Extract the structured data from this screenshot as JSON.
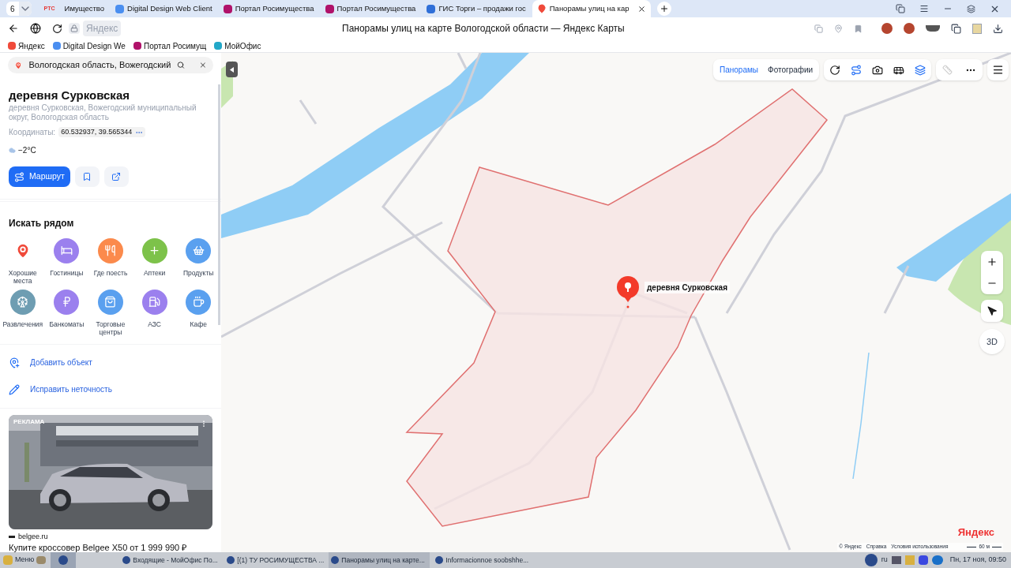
{
  "browser": {
    "tab_count": "6",
    "tabs": [
      {
        "title": "Имущество",
        "badge": "РТС",
        "selected": false
      },
      {
        "title": "Digital Design Web Client",
        "selected": false
      },
      {
        "title": "Портал Росимущества",
        "selected": false
      },
      {
        "title": "Портал Росимущества",
        "selected": false
      },
      {
        "title": "ГИС Торги – продажи гос",
        "selected": false
      },
      {
        "title": "Панорамы улиц на кар",
        "selected": true
      }
    ],
    "address": "Яндекс",
    "page_title": "Панорамы улиц на карте Вологодской области — Яндекс Карты",
    "bookmarks": [
      "Яндекс",
      "Digital Design We",
      "Портал Росимущ",
      "МойОфис"
    ]
  },
  "sidebar": {
    "search": {
      "value": "Вологодская область, Вожегодский"
    },
    "place": {
      "title": "деревня Сурковская",
      "address": "деревня Сурковская, Вожегодский муниципальный округ, Вологодская область",
      "coords_label": "Координаты:",
      "coords": "60.532937, 39.565344",
      "weather": "−2°C"
    },
    "route_button": "Маршрут",
    "nearby": {
      "title": "Искать рядом",
      "categories": [
        {
          "kind": "best",
          "label": "Хорошие места",
          "color": "#f04a3a"
        },
        {
          "kind": "hotel",
          "label": "Гостиницы",
          "color": "#9b80ee"
        },
        {
          "kind": "food",
          "label": "Где поесть",
          "color": "#fb8a4c"
        },
        {
          "kind": "pharmacy",
          "label": "Аптеки",
          "color": "#7dc24a"
        },
        {
          "kind": "grocery",
          "label": "Продукты",
          "color": "#5aa0ef"
        },
        {
          "kind": "fun",
          "label": "Развлечения",
          "color": "#6e9db2"
        },
        {
          "kind": "atm",
          "label": "Банкоматы",
          "color": "#9b80ee"
        },
        {
          "kind": "mall",
          "label": "Торговые центры",
          "color": "#5aa0ef"
        },
        {
          "kind": "fuel",
          "label": "АЗС",
          "color": "#9b80ee"
        },
        {
          "kind": "cafe",
          "label": "Кафе",
          "color": "#5aa0ef"
        }
      ]
    },
    "actions": [
      {
        "kind": "add",
        "label": "Добавить объект"
      },
      {
        "kind": "edit",
        "label": "Исправить неточность"
      }
    ],
    "ad": {
      "label": "РЕКЛАМА",
      "domain": "belgee.ru",
      "headline": "Купите кроссовер Belgee X50 от 1 999 990 ₽"
    }
  },
  "map": {
    "modes": [
      {
        "label": "Панорамы",
        "selected": true
      },
      {
        "label": "Фотографии",
        "selected": false
      }
    ],
    "marker_label": "деревня Сурковская",
    "view_3d": "3D",
    "logo": "Яндекс",
    "footer": [
      "© Яндекс",
      "Справка",
      "Условия использования"
    ],
    "scale": "60 м"
  },
  "taskbar": {
    "menu": "Меню",
    "windows": [
      {
        "title": "Входящие - МойОфис По...",
        "selected": false
      },
      {
        "title": "[(1) ТУ РОСИМУЩЕСТВА ...",
        "selected": false
      },
      {
        "title": "Панорамы улиц на карте...",
        "selected": true
      },
      {
        "title": "Informacionnoe soobshhe...",
        "selected": false
      }
    ],
    "lang": "ru",
    "clock": "Пн, 17 ноя, 09:50"
  }
}
